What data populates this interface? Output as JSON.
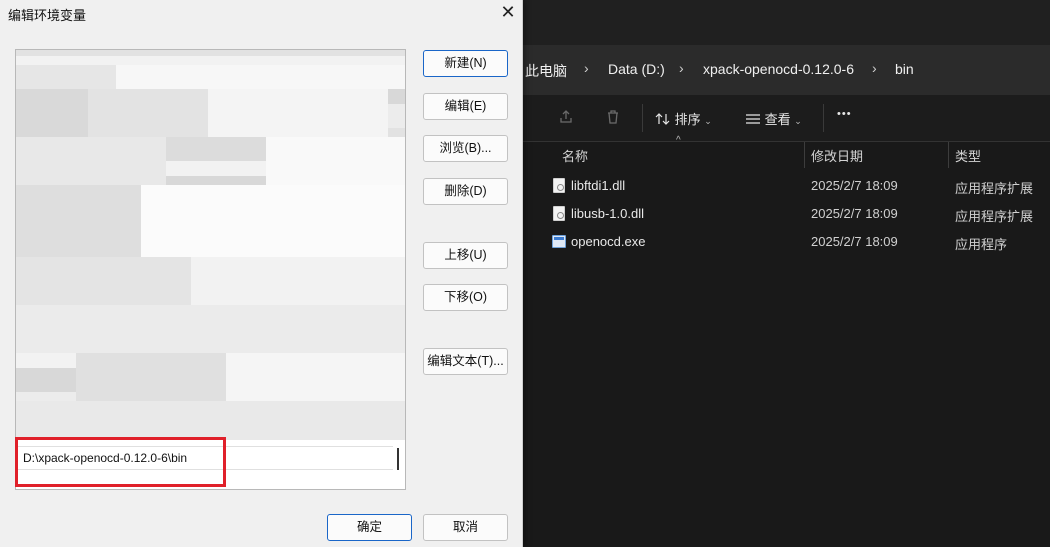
{
  "dialog": {
    "title": "编辑环境变量",
    "close_glyph": "✕",
    "edit_value": "D:\\xpack-openocd-0.12.0-6\\bin",
    "buttons": {
      "new": "新建(N)",
      "edit": "编辑(E)",
      "browse": "浏览(B)...",
      "delete": "删除(D)",
      "move_up": "上移(U)",
      "move_down": "下移(O)",
      "edit_text": "编辑文本(T)...",
      "ok": "确定",
      "cancel": "取消"
    },
    "highlight_color": "#e0202a"
  },
  "explorer": {
    "breadcrumb": [
      "此电脑",
      "Data (D:)",
      "xpack-openocd-0.12.0-6",
      "bin"
    ],
    "breadcrumb_separator": "›",
    "toolbar": {
      "sort_label": "排序",
      "view_label": "查看",
      "more_glyph": "•••"
    },
    "columns": {
      "name": "名称",
      "modified": "修改日期",
      "type": "类型"
    },
    "files": [
      {
        "name": "libftdi1.dll",
        "modified": "2025/2/7 18:09",
        "type": "应用程序扩展",
        "icon": "dll-file-icon"
      },
      {
        "name": "libusb-1.0.dll",
        "modified": "2025/2/7 18:09",
        "type": "应用程序扩展",
        "icon": "dll-file-icon"
      },
      {
        "name": "openocd.exe",
        "modified": "2025/2/7 18:09",
        "type": "应用程序",
        "icon": "exe-file-icon"
      }
    ]
  }
}
